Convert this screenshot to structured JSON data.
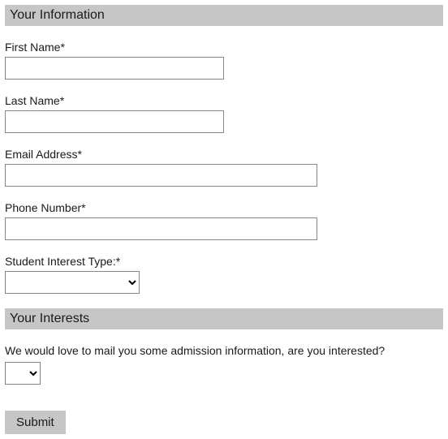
{
  "section1": {
    "title": "Your Information",
    "fields": {
      "firstName": {
        "label": "First Name*"
      },
      "lastName": {
        "label": "Last Name*"
      },
      "email": {
        "label": "Email Address*"
      },
      "phone": {
        "label": "Phone Number*"
      },
      "interestType": {
        "label": "Student Interest Type:*"
      }
    }
  },
  "section2": {
    "title": "Your Interests",
    "question": "We would love to mail you some admission information, are you interested?"
  },
  "submit": {
    "label": "Submit"
  }
}
